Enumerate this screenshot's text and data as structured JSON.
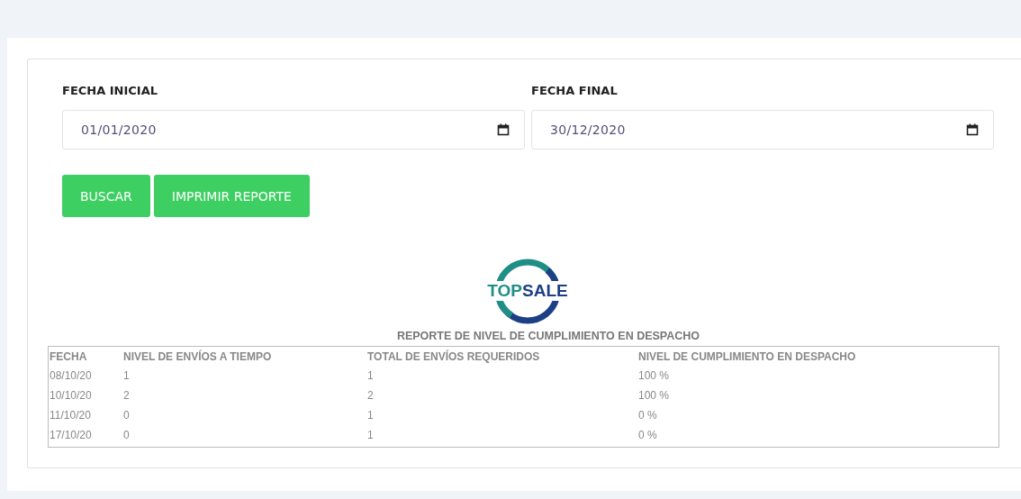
{
  "filters": [
    {
      "label": "FECHA INICIAL",
      "value": "01/01/2020"
    },
    {
      "label": "FECHA FINAL",
      "value": "30/12/2020"
    }
  ],
  "buttons": [
    "BUSCAR",
    "IMPRIMIR REPORTE"
  ],
  "logo": {
    "parts": [
      {
        "text": "TOP",
        "color": "#1f8f86"
      },
      {
        "text": "SALE",
        "color": "#1d3f86"
      }
    ]
  },
  "report": {
    "title": "REPORTE DE NIVEL DE CUMPLIMIENTO EN DESPACHO",
    "columns": [
      "FECHA",
      "NIVEL DE ENVÍOS A TIEMPO",
      "TOTAL DE ENVÍOS REQUERIDOS",
      "NIVEL DE CUMPLIMIENTO EN DESPACHO"
    ],
    "rows": [
      [
        "08/10/20",
        "1",
        "1",
        "100 %"
      ],
      [
        "10/10/20",
        "2",
        "2",
        "100 %"
      ],
      [
        "11/10/20",
        "0",
        "1",
        "0 %"
      ],
      [
        "17/10/20",
        "0",
        "1",
        "0 %"
      ]
    ]
  }
}
